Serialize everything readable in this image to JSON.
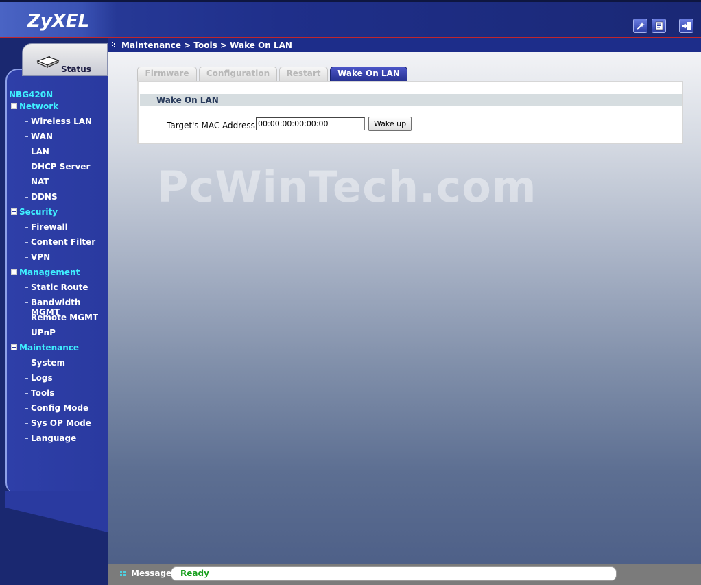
{
  "header": {
    "logo": "ZyXEL",
    "icons": [
      "wizard-icon",
      "help-icon",
      "logout-icon"
    ]
  },
  "breadcrumb": "Maintenance > Tools > Wake On LAN",
  "sidebar": {
    "status_label": "Status",
    "device_name": "NBG420N",
    "groups": [
      {
        "label": "Network",
        "items": [
          "Wireless LAN",
          "WAN",
          "LAN",
          "DHCP Server",
          "NAT",
          "DDNS"
        ]
      },
      {
        "label": "Security",
        "items": [
          "Firewall",
          "Content Filter",
          "VPN"
        ]
      },
      {
        "label": "Management",
        "items": [
          "Static Route",
          "Bandwidth MGMT",
          "Remote MGMT",
          "UPnP"
        ]
      },
      {
        "label": "Maintenance",
        "items": [
          "System",
          "Logs",
          "Tools",
          "Config Mode",
          "Sys OP Mode",
          "Language"
        ]
      }
    ]
  },
  "tabs": [
    {
      "label": "Firmware",
      "active": false
    },
    {
      "label": "Configuration",
      "active": false
    },
    {
      "label": "Restart",
      "active": false
    },
    {
      "label": "Wake On LAN",
      "active": true
    }
  ],
  "panel": {
    "title": "Wake On LAN",
    "mac_label": "Target's MAC Address",
    "mac_value": "00:00:00:00:00:00",
    "wake_button": "Wake up"
  },
  "watermark": "PcWinTech.com",
  "statusbar": {
    "label": "Message",
    "value": "Ready"
  },
  "colors": {
    "accent_cyan": "#3ff0ff",
    "sidebar_blue": "#2a3aa0",
    "header_red_line": "#c0262c",
    "status_ready": "#1aa020"
  }
}
